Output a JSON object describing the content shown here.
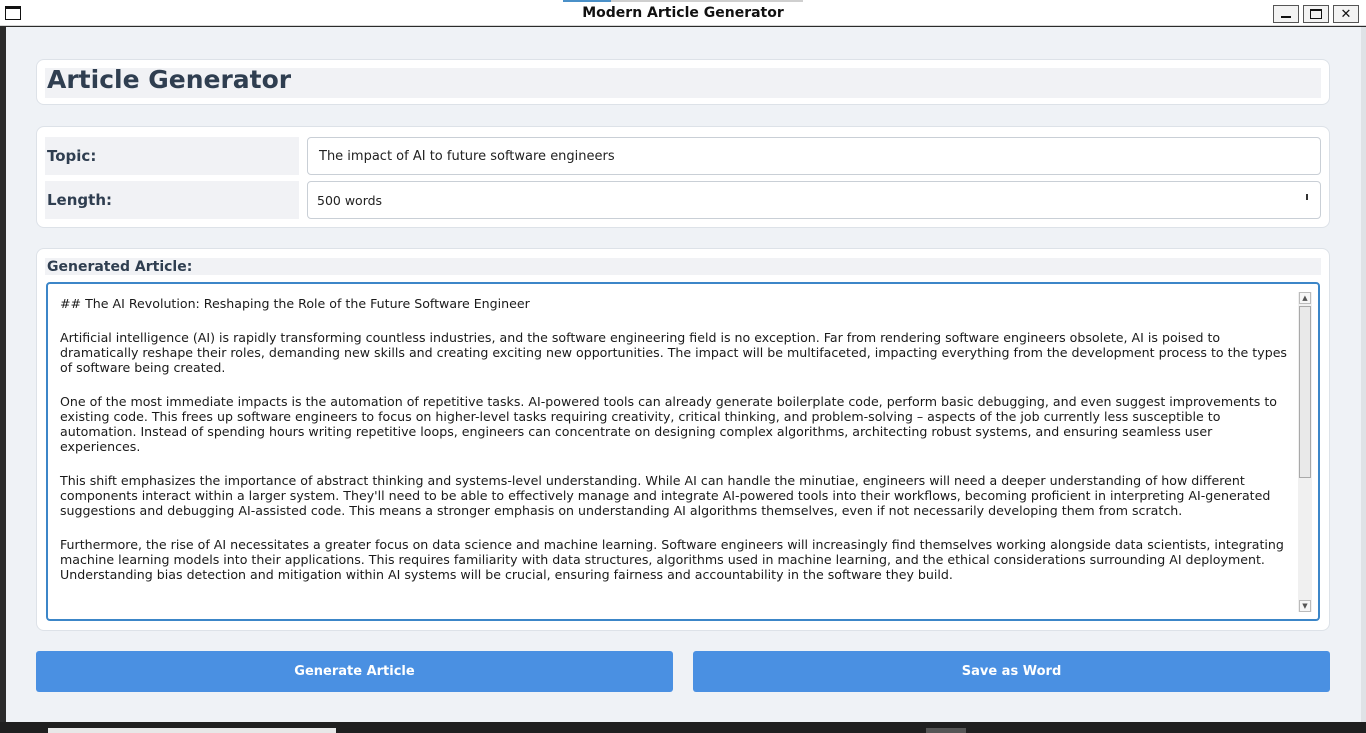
{
  "window": {
    "title": "Modern Article Generator"
  },
  "header": {
    "title": "Article Generator"
  },
  "form": {
    "topic_label": "Topic:",
    "topic_value": "The impact of AI to future software engineers",
    "length_label": "Length:",
    "length_value": "500 words"
  },
  "article": {
    "label": "Generated Article:",
    "paragraphs": [
      "## The AI Revolution: Reshaping the Role of the Future Software Engineer",
      "Artificial intelligence (AI) is rapidly transforming countless industries, and the software engineering field is no exception.  Far from rendering software engineers obsolete, AI is poised to dramatically reshape their roles, demanding new skills and creating exciting new opportunities.  The impact will be multifaceted, impacting everything from the development process to the types of software being created.",
      "One of the most immediate impacts is the automation of repetitive tasks.  AI-powered tools can already generate boilerplate code, perform basic debugging, and even suggest improvements to existing code. This frees up software engineers to focus on higher-level tasks requiring creativity, critical thinking, and problem-solving – aspects of the job currently less susceptible to automation.  Instead of spending hours writing repetitive loops, engineers can concentrate on designing complex algorithms, architecting robust systems, and ensuring seamless user experiences.",
      "This shift emphasizes the importance of abstract thinking and systems-level understanding.  While AI can handle the minutiae, engineers will need a deeper understanding of how different components interact within a larger system.  They'll need to be able to effectively manage and integrate AI-powered tools into their workflows, becoming proficient in interpreting AI-generated suggestions and debugging AI-assisted code.  This means a stronger emphasis on understanding AI algorithms themselves, even if not necessarily developing them from scratch.",
      "Furthermore, the rise of AI necessitates a greater focus on data science and machine learning.  Software engineers will increasingly find themselves working alongside data scientists, integrating machine learning models into their applications.  This requires familiarity with data structures, algorithms used in machine learning, and the ethical considerations surrounding AI deployment.  Understanding bias detection and mitigation within AI systems will be crucial, ensuring fairness and accountability in the software they build."
    ]
  },
  "buttons": {
    "generate_label": "Generate Article",
    "save_label": "Save as Word"
  },
  "icons": {
    "window_minimize": "minimize-icon",
    "window_maximize": "maximize-icon",
    "window_close": "close-icon",
    "scroll_up": "scroll-up-arrow-icon",
    "scroll_down": "scroll-down-arrow-icon"
  },
  "colors": {
    "primary_button": "#4a90e2",
    "focus_border": "#3c86c8",
    "heading_text": "#2f3e50",
    "background": "#eff2f6"
  }
}
